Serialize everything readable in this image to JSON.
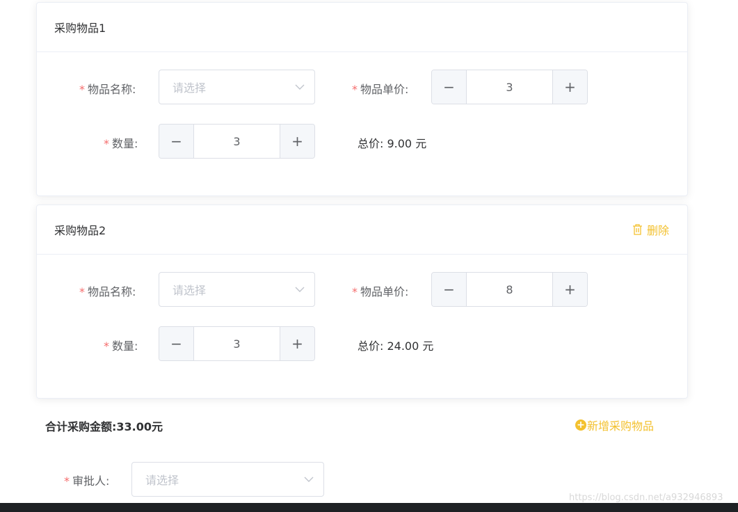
{
  "items": [
    {
      "title": "采购物品1",
      "name_label": "物品名称:",
      "name_placeholder": "请选择",
      "price_label": "物品单价:",
      "price_value": "3",
      "qty_label": "数量:",
      "qty_value": "3",
      "total_text": "总价: 9.00 元"
    },
    {
      "title": "采购物品2",
      "delete_label": "删除",
      "name_label": "物品名称:",
      "name_placeholder": "请选择",
      "price_label": "物品单价:",
      "price_value": "8",
      "qty_label": "数量:",
      "qty_value": "3",
      "total_text": "总价: 24.00 元"
    }
  ],
  "summary": {
    "total_text": "合计采购金额:33.00元",
    "add_label": "新增采购物品"
  },
  "approver": {
    "label": "审批人:",
    "placeholder": "请选择"
  },
  "required_mark": "*",
  "stepper": {
    "minus": "−",
    "plus": "+"
  },
  "watermark": "https://blog.csdn.net/a932946893",
  "colors": {
    "accent": "#f3c12f",
    "required": "#f56c6c",
    "border": "#dcdfe6"
  }
}
